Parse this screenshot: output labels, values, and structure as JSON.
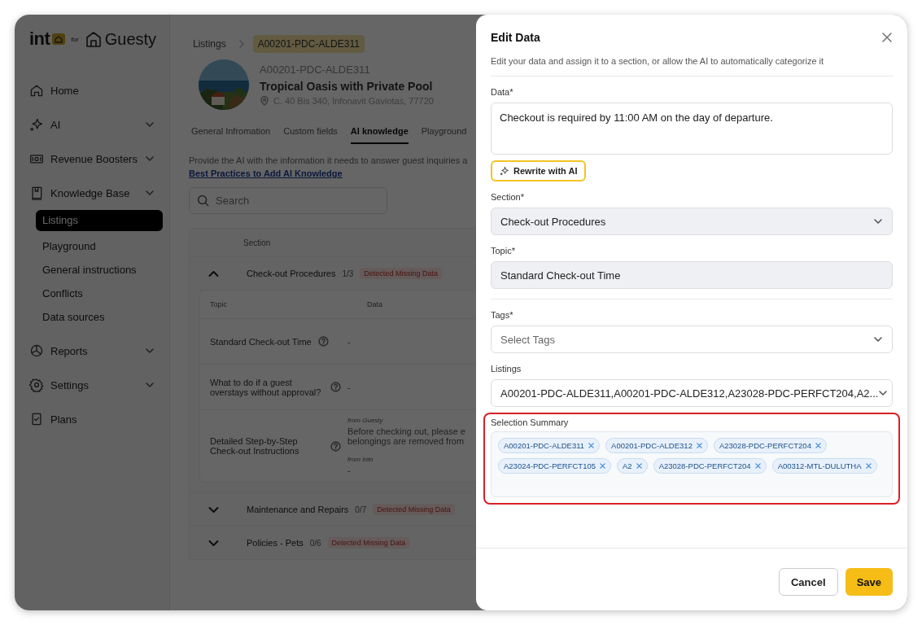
{
  "logo": {
    "brand": "int",
    "connector": "for",
    "partner": "Guesty"
  },
  "sidebar": {
    "items": [
      {
        "label": "Home",
        "has_submenu": false
      },
      {
        "label": "AI",
        "has_submenu": true
      },
      {
        "label": "Revenue Boosters",
        "has_submenu": true
      },
      {
        "label": "Knowledge Base",
        "has_submenu": true,
        "expanded": true,
        "children": [
          {
            "label": "Listings",
            "selected": true
          },
          {
            "label": "Playground",
            "selected": false
          },
          {
            "label": "General instructions",
            "selected": false
          },
          {
            "label": "Conflicts",
            "selected": false
          },
          {
            "label": "Data sources",
            "selected": false
          }
        ]
      },
      {
        "label": "Reports",
        "has_submenu": true
      },
      {
        "label": "Settings",
        "has_submenu": true
      },
      {
        "label": "Plans",
        "has_submenu": false
      }
    ]
  },
  "breadcrumb": [
    "Listings",
    "A00201-PDC-ALDE311"
  ],
  "listing": {
    "code": "A00201-PDC-ALDE311",
    "name": "Tropical Oasis with Private Pool",
    "address": "C. 40 Bis 340, Infonavit Gaviotas, 77720"
  },
  "tabs": [
    {
      "label": "General Infromation",
      "selected": false
    },
    {
      "label": "Custom fields",
      "selected": false
    },
    {
      "label": "AI knowledge",
      "selected": true
    },
    {
      "label": "Playground",
      "selected": false
    }
  ],
  "intro": {
    "text": "Provide the AI with the information it needs to answer guest inquiries a",
    "link": "Best Practices to Add AI Knowledge"
  },
  "search": {
    "placeholder": "Search"
  },
  "sections_table": {
    "column": "Section",
    "inner_columns": [
      "Topic",
      "Data"
    ],
    "rows": [
      {
        "name": "Check-out Procedures",
        "count": "1/3",
        "badge": "Detected Missing Data",
        "expanded": true,
        "topics": [
          {
            "topic": "Standard Check-out Time",
            "data": [
              {
                "text": "-"
              }
            ]
          },
          {
            "topic": "What to do if a guest overstays without approval?",
            "data": [
              {
                "text": "-"
              }
            ]
          },
          {
            "topic": "Detailed Step-by-Step Check-out Instructions",
            "data": [
              {
                "source": "from Guesty",
                "text": "Before checking out, please e belongings are removed from"
              },
              {
                "source": "from Into",
                "text": "-"
              }
            ]
          }
        ]
      },
      {
        "name": "Maintenance and Repairs",
        "count": "0/7",
        "badge": "Detected Missing Data",
        "expanded": false
      },
      {
        "name": "Policies - Pets",
        "count": "0/6",
        "badge": "Detected Missing Data",
        "expanded": false
      }
    ]
  },
  "drawer": {
    "title": "Edit Data",
    "subtitle": "Edit your data and assign it to a section, or allow the AI to automatically categorize it",
    "fields": [
      {
        "kind": "textarea",
        "label": "Data*",
        "value": "Checkout is required by 11:00 AM on the day of departure.",
        "action": "Rewrite with AI"
      },
      {
        "kind": "select",
        "label": "Section*",
        "value": "Check-out Procedures",
        "filled": true
      },
      {
        "kind": "input",
        "label": "Topic*",
        "value": "Standard Check-out Time",
        "filled": true,
        "divider_after": true
      },
      {
        "kind": "select",
        "label": "Tags*",
        "placeholder": "Select Tags",
        "filled": false
      },
      {
        "kind": "select",
        "label": "Listings",
        "value": "A00201-PDC-ALDE311,A00201-PDC-ALDE312,A23028-PDC-PERFCT204,A2...",
        "filled": false
      },
      {
        "kind": "chips",
        "label": "Selection Summary",
        "highlighted": true,
        "chips": [
          "A00201-PDC-ALDE311",
          "A00201-PDC-ALDE312",
          "A23028-PDC-PERFCT204",
          "A23024-PDC-PERFCT105",
          "A2",
          "A23028-PDC-PERFCT204",
          "A00312-MTL-DULUTHA"
        ]
      }
    ],
    "buttons": [
      {
        "label": "Cancel",
        "kind": "secondary"
      },
      {
        "label": "Save",
        "kind": "primary"
      }
    ]
  }
}
